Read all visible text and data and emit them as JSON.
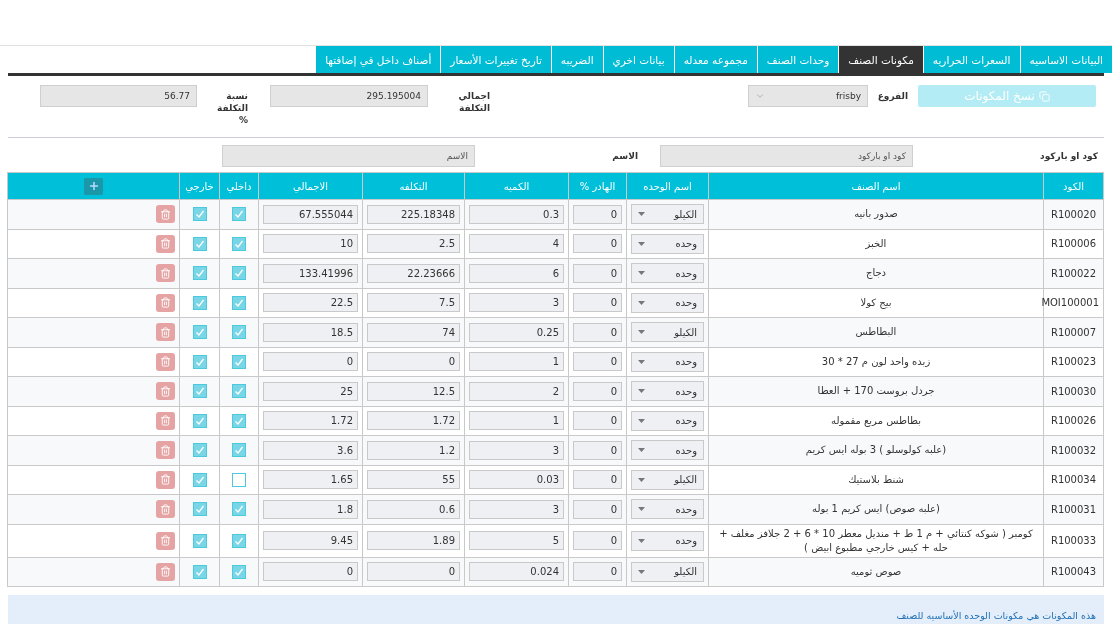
{
  "tabs": [
    {
      "label": "البيانات الاساسيه",
      "selected": false
    },
    {
      "label": "السعرات الحراريه",
      "selected": false
    },
    {
      "label": "مكونات الصنف",
      "selected": true
    },
    {
      "label": "وحدات الصنف",
      "selected": false
    },
    {
      "label": "مجموعه معدله",
      "selected": false
    },
    {
      "label": "بيانات اخري",
      "selected": false
    },
    {
      "label": "الضريبه",
      "selected": false
    },
    {
      "label": "تاريخ تغييرات الأسعار",
      "selected": false
    },
    {
      "label": "أصناف داخل في إضافتها",
      "selected": false
    }
  ],
  "copy_button": {
    "label": "نسخ المكونات",
    "disabled": true
  },
  "branch": {
    "label": "الفروع",
    "value": "frisby"
  },
  "total_cost": {
    "label": "اجمالي التكلفة",
    "value": "295.195004"
  },
  "cost_ratio": {
    "label": "نسبة التكلفة %",
    "value": "56.77"
  },
  "search": {
    "code_label": "كود او باركود",
    "code_placeholder": "كود او باركود",
    "name_label": "الاسم",
    "name_placeholder": "الاسم"
  },
  "table": {
    "columns": [
      "الكود",
      "اسم الصنف",
      "اسم الوحده",
      "الهادر %",
      "الكميه",
      "التكلفه",
      "الاجمالي",
      "داخلي",
      "خارجي"
    ],
    "rows": [
      {
        "code": "R100020",
        "name": "صدور بانيه",
        "unit": "الكيلو",
        "waste": "0",
        "quantity": "0.3",
        "cost": "225.18348",
        "total": "67.555044",
        "internal": true,
        "external": true
      },
      {
        "code": "R100006",
        "name": "الخبز",
        "unit": "وحده",
        "waste": "0",
        "quantity": "4",
        "cost": "2.5",
        "total": "10",
        "internal": true,
        "external": true
      },
      {
        "code": "R100022",
        "name": "دجاج",
        "unit": "وحده",
        "waste": "0",
        "quantity": "6",
        "cost": "22.23666",
        "total": "133.41996",
        "internal": true,
        "external": true
      },
      {
        "code": "MOI100001",
        "name": "بيج كولا",
        "unit": "وحده",
        "waste": "0",
        "quantity": "3",
        "cost": "7.5",
        "total": "22.5",
        "internal": true,
        "external": true
      },
      {
        "code": "R100007",
        "name": "البطاطس",
        "unit": "الكيلو",
        "waste": "0",
        "quantity": "0.25",
        "cost": "74",
        "total": "18.5",
        "internal": true,
        "external": true
      },
      {
        "code": "R100023",
        "name": "زبده واحد لون م 27 * 30",
        "unit": "وحده",
        "waste": "0",
        "quantity": "1",
        "cost": "0",
        "total": "0",
        "internal": true,
        "external": true
      },
      {
        "code": "R100030",
        "name": "جردل بروست 170 + العطا",
        "unit": "وحده",
        "waste": "0",
        "quantity": "2",
        "cost": "12.5",
        "total": "25",
        "internal": true,
        "external": true
      },
      {
        "code": "R100026",
        "name": "بطاطس مربع مقموله",
        "unit": "وحده",
        "waste": "0",
        "quantity": "1",
        "cost": "1.72",
        "total": "1.72",
        "internal": true,
        "external": true
      },
      {
        "code": "R100032",
        "name": "(علبه كولوسلو ) 3 بوله ايس كريم",
        "unit": "وحده",
        "waste": "0",
        "quantity": "3",
        "cost": "1.2",
        "total": "3.6",
        "internal": true,
        "external": true
      },
      {
        "code": "R100034",
        "name": "شنط بلاستيك",
        "unit": "الكيلو",
        "waste": "0",
        "quantity": "0.03",
        "cost": "55",
        "total": "1.65",
        "internal": false,
        "external": true
      },
      {
        "code": "R100031",
        "name": "(علبه صوص) ايس كريم 1 بوله",
        "unit": "وحده",
        "waste": "0",
        "quantity": "3",
        "cost": "0.6",
        "total": "1.8",
        "internal": true,
        "external": true
      },
      {
        "code": "R100033",
        "name": "كومبر ( شوكه كنتائي + م 1 ط + منديل معطر 10 * 6 + 2 جلافز مغلف + حله + كيس خارجي مطبوع ابيض )",
        "unit": "وحده",
        "waste": "0",
        "quantity": "5",
        "cost": "1.89",
        "total": "9.45",
        "internal": true,
        "external": true
      },
      {
        "code": "R100043",
        "name": "صوص ثوميه",
        "unit": "الكيلو",
        "waste": "0",
        "quantity": "0.024",
        "cost": "0",
        "total": "0",
        "internal": true,
        "external": true
      }
    ]
  },
  "note": "هذه المكونات هي مكونات الوحده الأساسيه للصنف"
}
